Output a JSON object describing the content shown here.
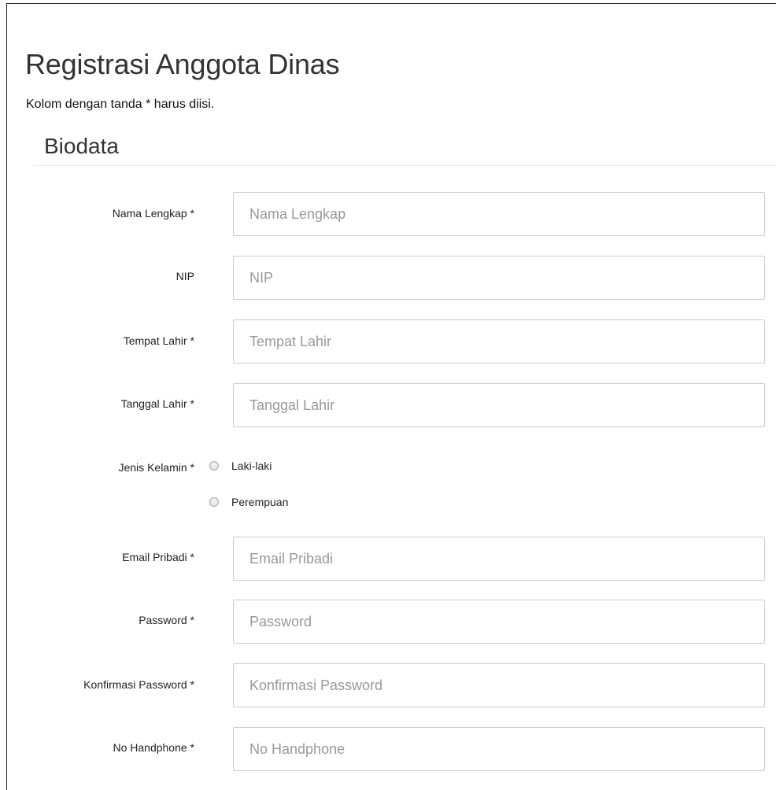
{
  "header": {
    "title": "Registrasi Anggota Dinas",
    "hint": "Kolom dengan tanda * harus diisi."
  },
  "section": {
    "title": "Biodata"
  },
  "fields": {
    "nama": {
      "label": "Nama Lengkap *",
      "placeholder": "Nama Lengkap"
    },
    "nip": {
      "label": "NIP",
      "placeholder": "NIP"
    },
    "tempat": {
      "label": "Tempat Lahir *",
      "placeholder": "Tempat Lahir"
    },
    "tanggal": {
      "label": "Tanggal Lahir *",
      "placeholder": "Tanggal Lahir"
    },
    "email": {
      "label": "Email Pribadi *",
      "placeholder": "Email Pribadi"
    },
    "password": {
      "label": "Password *",
      "placeholder": "Password"
    },
    "konfirmasi": {
      "label": "Konfirmasi Password *",
      "placeholder": "Konfirmasi Password"
    },
    "handphone": {
      "label": "No Handphone *",
      "placeholder": "No Handphone"
    }
  },
  "gender": {
    "label": "Jenis Kelamin *",
    "options": [
      "Laki-laki",
      "Perempuan"
    ],
    "selected": null
  }
}
